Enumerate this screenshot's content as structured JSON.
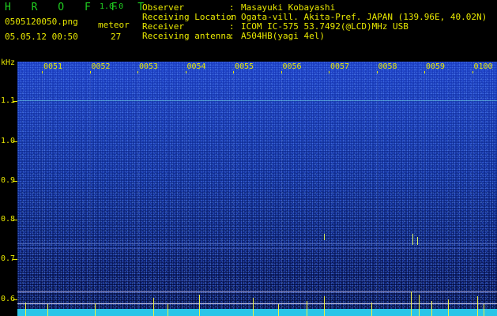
{
  "header": {
    "app_name": "H R O F F T",
    "version": "1.0.0",
    "filename": "0505120050.png",
    "datetime": "05.05.12 00:50",
    "meteor_label": "meteor",
    "meteor_count": "27"
  },
  "station": {
    "observer_label": "Observer",
    "observer_value": "Masayuki Kobayashi",
    "location_label": "Receiving Location",
    "location_value": "Ogata-vill. Akita-Pref. JAPAN (139.96E, 40.02N)",
    "receiver_label": "Receiver",
    "receiver_value": "ICOM IC-575 53.7492(@LCD)MHz USB",
    "antenna_label": "Receiving antenna",
    "antenna_value": "A504HB(yagi 4el)",
    "separator": ":"
  },
  "spectrogram": {
    "y_unit": "kHz",
    "y_ticks": [
      "1.1",
      "1.0",
      "0.9",
      "0.8",
      "0.7",
      "0.6"
    ],
    "x_ticks": [
      "0051",
      "0052",
      "0053",
      "0054",
      "0055",
      "0056",
      "0057",
      "0058",
      "0059",
      "0100"
    ],
    "colors": {
      "background": "#071a6e",
      "floor": "#29c5e8",
      "text": "#e8e800",
      "title": "#20d020"
    }
  }
}
